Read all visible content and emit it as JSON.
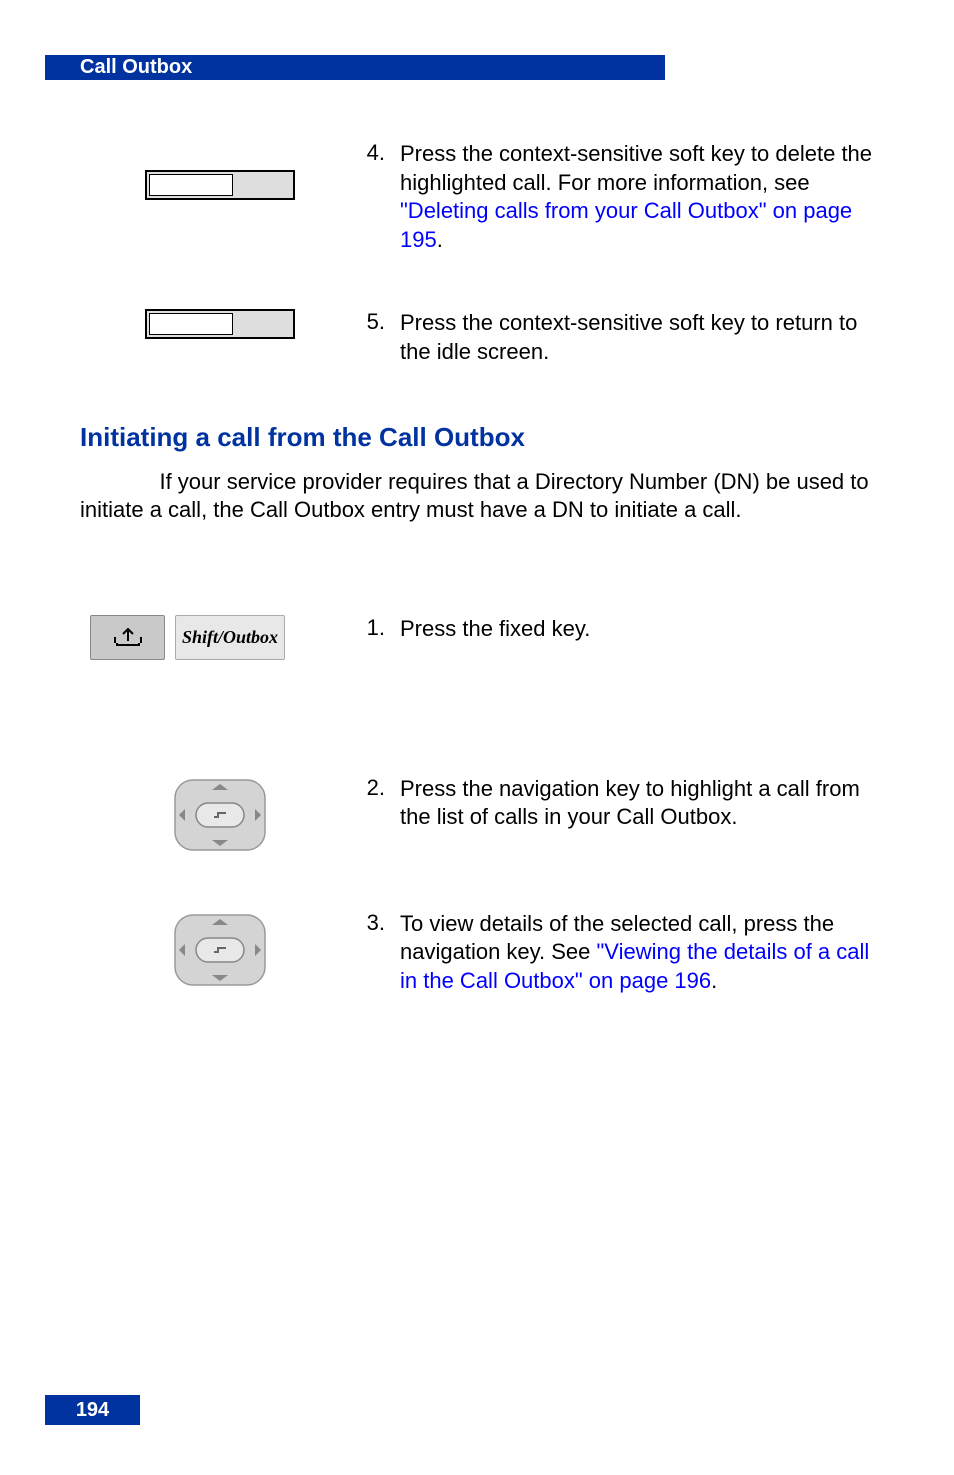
{
  "header": {
    "title": "Call Outbox"
  },
  "pageNumber": "194",
  "topSteps": [
    {
      "num": "4.",
      "pre": "Press the ",
      "bold": "",
      "mid": " context-sensitive soft key to delete the highlighted call. For more information, see ",
      "link": "\"Deleting calls from your Call Outbox\" on page 195",
      "post": "."
    },
    {
      "num": "5.",
      "pre": "Press the ",
      "bold": "",
      "mid": " context-sensitive soft key to return to the idle screen.",
      "link": "",
      "post": ""
    }
  ],
  "section": {
    "heading": "Initiating a call from the Call Outbox",
    "noteLabel": "",
    "noteBody": "If your service provider requires that a Directory Number (DN) be used to initiate a call, the Call Outbox entry must have a DN to initiate a call."
  },
  "shiftLabel": "Shift/Outbox",
  "bottomSteps": [
    {
      "num": "1.",
      "pre": "Press the ",
      "bold": "",
      "mid": " fixed key.",
      "link": "",
      "post": ""
    },
    {
      "num": "2.",
      "pre": "Press the ",
      "bold": "",
      "mid": " navigation key to highlight a call from the list of calls in your Call Outbox.",
      "link": "",
      "post": ""
    },
    {
      "num": "3.",
      "pre": "To view details of the selected call, press the ",
      "bold": "",
      "mid": " navigation key. See ",
      "link": "\"Viewing the details of a call in the Call Outbox\" on page 196",
      "post": "."
    }
  ]
}
